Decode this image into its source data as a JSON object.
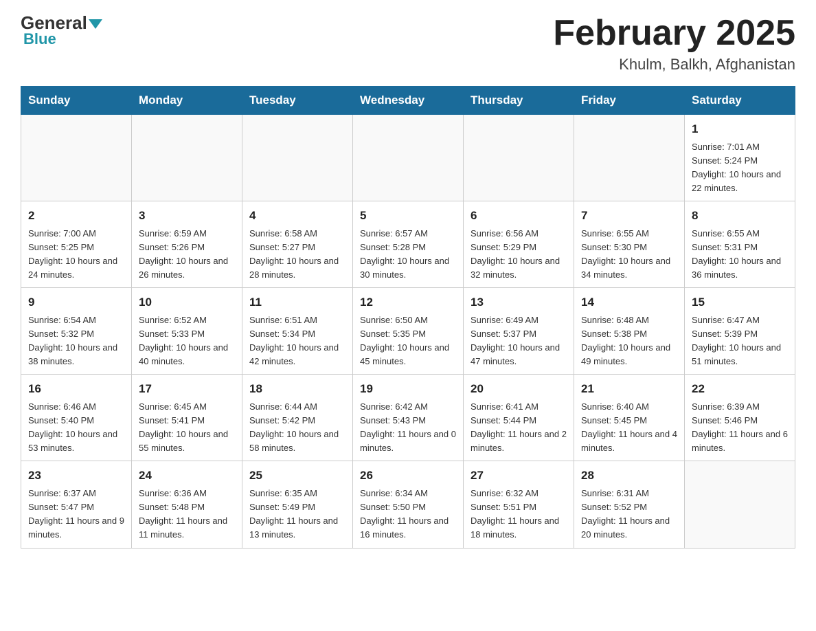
{
  "header": {
    "logo_general": "General",
    "logo_blue": "Blue",
    "month_year": "February 2025",
    "location": "Khulm, Balkh, Afghanistan"
  },
  "days_of_week": [
    "Sunday",
    "Monday",
    "Tuesday",
    "Wednesday",
    "Thursday",
    "Friday",
    "Saturday"
  ],
  "weeks": [
    [
      {
        "day": "",
        "info": ""
      },
      {
        "day": "",
        "info": ""
      },
      {
        "day": "",
        "info": ""
      },
      {
        "day": "",
        "info": ""
      },
      {
        "day": "",
        "info": ""
      },
      {
        "day": "",
        "info": ""
      },
      {
        "day": "1",
        "info": "Sunrise: 7:01 AM\nSunset: 5:24 PM\nDaylight: 10 hours\nand 22 minutes."
      }
    ],
    [
      {
        "day": "2",
        "info": "Sunrise: 7:00 AM\nSunset: 5:25 PM\nDaylight: 10 hours\nand 24 minutes."
      },
      {
        "day": "3",
        "info": "Sunrise: 6:59 AM\nSunset: 5:26 PM\nDaylight: 10 hours\nand 26 minutes."
      },
      {
        "day": "4",
        "info": "Sunrise: 6:58 AM\nSunset: 5:27 PM\nDaylight: 10 hours\nand 28 minutes."
      },
      {
        "day": "5",
        "info": "Sunrise: 6:57 AM\nSunset: 5:28 PM\nDaylight: 10 hours\nand 30 minutes."
      },
      {
        "day": "6",
        "info": "Sunrise: 6:56 AM\nSunset: 5:29 PM\nDaylight: 10 hours\nand 32 minutes."
      },
      {
        "day": "7",
        "info": "Sunrise: 6:55 AM\nSunset: 5:30 PM\nDaylight: 10 hours\nand 34 minutes."
      },
      {
        "day": "8",
        "info": "Sunrise: 6:55 AM\nSunset: 5:31 PM\nDaylight: 10 hours\nand 36 minutes."
      }
    ],
    [
      {
        "day": "9",
        "info": "Sunrise: 6:54 AM\nSunset: 5:32 PM\nDaylight: 10 hours\nand 38 minutes."
      },
      {
        "day": "10",
        "info": "Sunrise: 6:52 AM\nSunset: 5:33 PM\nDaylight: 10 hours\nand 40 minutes."
      },
      {
        "day": "11",
        "info": "Sunrise: 6:51 AM\nSunset: 5:34 PM\nDaylight: 10 hours\nand 42 minutes."
      },
      {
        "day": "12",
        "info": "Sunrise: 6:50 AM\nSunset: 5:35 PM\nDaylight: 10 hours\nand 45 minutes."
      },
      {
        "day": "13",
        "info": "Sunrise: 6:49 AM\nSunset: 5:37 PM\nDaylight: 10 hours\nand 47 minutes."
      },
      {
        "day": "14",
        "info": "Sunrise: 6:48 AM\nSunset: 5:38 PM\nDaylight: 10 hours\nand 49 minutes."
      },
      {
        "day": "15",
        "info": "Sunrise: 6:47 AM\nSunset: 5:39 PM\nDaylight: 10 hours\nand 51 minutes."
      }
    ],
    [
      {
        "day": "16",
        "info": "Sunrise: 6:46 AM\nSunset: 5:40 PM\nDaylight: 10 hours\nand 53 minutes."
      },
      {
        "day": "17",
        "info": "Sunrise: 6:45 AM\nSunset: 5:41 PM\nDaylight: 10 hours\nand 55 minutes."
      },
      {
        "day": "18",
        "info": "Sunrise: 6:44 AM\nSunset: 5:42 PM\nDaylight: 10 hours\nand 58 minutes."
      },
      {
        "day": "19",
        "info": "Sunrise: 6:42 AM\nSunset: 5:43 PM\nDaylight: 11 hours\nand 0 minutes."
      },
      {
        "day": "20",
        "info": "Sunrise: 6:41 AM\nSunset: 5:44 PM\nDaylight: 11 hours\nand 2 minutes."
      },
      {
        "day": "21",
        "info": "Sunrise: 6:40 AM\nSunset: 5:45 PM\nDaylight: 11 hours\nand 4 minutes."
      },
      {
        "day": "22",
        "info": "Sunrise: 6:39 AM\nSunset: 5:46 PM\nDaylight: 11 hours\nand 6 minutes."
      }
    ],
    [
      {
        "day": "23",
        "info": "Sunrise: 6:37 AM\nSunset: 5:47 PM\nDaylight: 11 hours\nand 9 minutes."
      },
      {
        "day": "24",
        "info": "Sunrise: 6:36 AM\nSunset: 5:48 PM\nDaylight: 11 hours\nand 11 minutes."
      },
      {
        "day": "25",
        "info": "Sunrise: 6:35 AM\nSunset: 5:49 PM\nDaylight: 11 hours\nand 13 minutes."
      },
      {
        "day": "26",
        "info": "Sunrise: 6:34 AM\nSunset: 5:50 PM\nDaylight: 11 hours\nand 16 minutes."
      },
      {
        "day": "27",
        "info": "Sunrise: 6:32 AM\nSunset: 5:51 PM\nDaylight: 11 hours\nand 18 minutes."
      },
      {
        "day": "28",
        "info": "Sunrise: 6:31 AM\nSunset: 5:52 PM\nDaylight: 11 hours\nand 20 minutes."
      },
      {
        "day": "",
        "info": ""
      }
    ]
  ]
}
